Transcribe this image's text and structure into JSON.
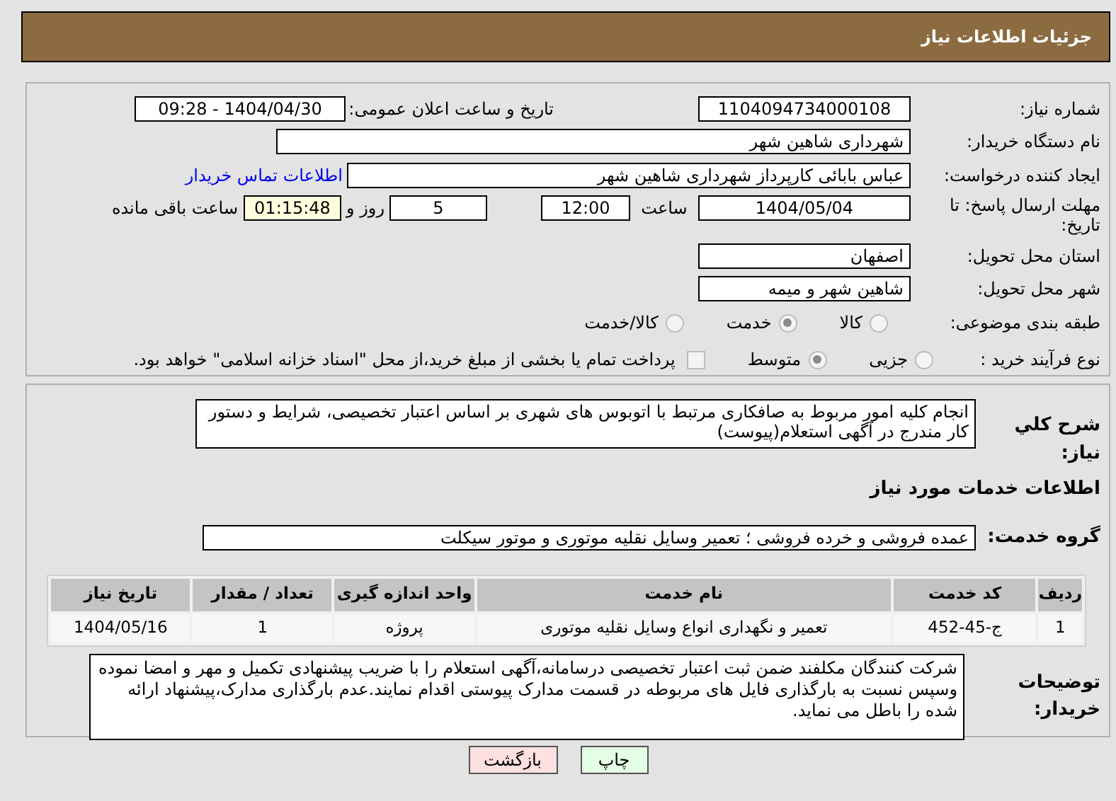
{
  "title": "جزئیات اطلاعات نیاز",
  "need_number": {
    "label": "شماره نیاز:",
    "value": "1104094734000108"
  },
  "announce": {
    "label": "تاریخ و ساعت اعلان عمومی:",
    "value": "1404/04/30 - 09:28"
  },
  "buyer_org": {
    "label": "نام دستگاه خریدار:",
    "value": "شهرداری شاهین شهر"
  },
  "requester": {
    "label": "ایجاد کننده درخواست:",
    "value": "عباس بابائی کارپرداز شهرداری شاهین شهر",
    "link": "اطلاعات تماس خریدار"
  },
  "deadline": {
    "label": "مهلت ارسال پاسخ: تا تاریخ:",
    "date": "1404/05/04",
    "time_label": "ساعت",
    "time": "12:00",
    "days": "5",
    "days_label": "روز و",
    "remaining": "01:15:48",
    "remaining_label": "ساعت باقی مانده"
  },
  "province": {
    "label": "استان محل تحویل:",
    "value": "اصفهان"
  },
  "city": {
    "label": "شهر محل تحویل:",
    "value": "شاهین شهر و میمه"
  },
  "category": {
    "label": "طبقه بندی موضوعی:",
    "options": [
      {
        "label": "کالا",
        "selected": false
      },
      {
        "label": "خدمت",
        "selected": true
      },
      {
        "label": "کالا/خدمت",
        "selected": false
      }
    ]
  },
  "purchase_type": {
    "label": "نوع فرآیند خرید :",
    "options": [
      {
        "label": "جزیی",
        "selected": false
      },
      {
        "label": "متوسط",
        "selected": true
      }
    ],
    "payment_checkbox": {
      "label": "پرداخت تمام یا بخشی از مبلغ خرید،از محل \"اسناد خزانه اسلامی\" خواهد بود.",
      "checked": false
    }
  },
  "description": {
    "label": "شرح کلي نياز:",
    "value": "انجام کلیه امور مربوط به صافکاری مرتبط با اتوبوس های شهری بر اساس اعتبار تخصیصی، شرایط و دستور کار مندرج در آگهی استعلام(پیوست)"
  },
  "services_heading": "اطلاعات خدمات مورد نیاز",
  "service_group": {
    "label": "گروه خدمت:",
    "value": "عمده فروشی و خرده فروشی ؛ تعمیر وسایل نقلیه موتوری و موتور سیکلت"
  },
  "table": {
    "columns": [
      "ردیف",
      "کد خدمت",
      "نام خدمت",
      "واحد اندازه گیری",
      "تعداد / مقدار",
      "تاریخ نیاز"
    ],
    "rows": [
      [
        "1",
        "ج-45-452",
        "تعمیر و نگهداری انواع وسایل نقلیه موتوری",
        "پروژه",
        "1",
        "1404/05/16"
      ]
    ]
  },
  "buyer_notes": {
    "label": "توضیحات خریدار:",
    "value": "شرکت کنندگان مکلفند ضمن ثبت اعتبار تخصیصی درسامانه،آگهی استعلام را با ضریب پیشنهادی تکمیل و مهر و امضا نموده وسپس نسبت به بارگذاری فایل های مربوطه در قسمت مدارک پیوستی اقدام نمایند.عدم بارگذاری مدارک،پیشنهاد ارائه شده را باطل می نماید."
  },
  "buttons": [
    {
      "label": "چاپ",
      "kind": "print"
    },
    {
      "label": "بازگشت",
      "kind": "back"
    }
  ]
}
